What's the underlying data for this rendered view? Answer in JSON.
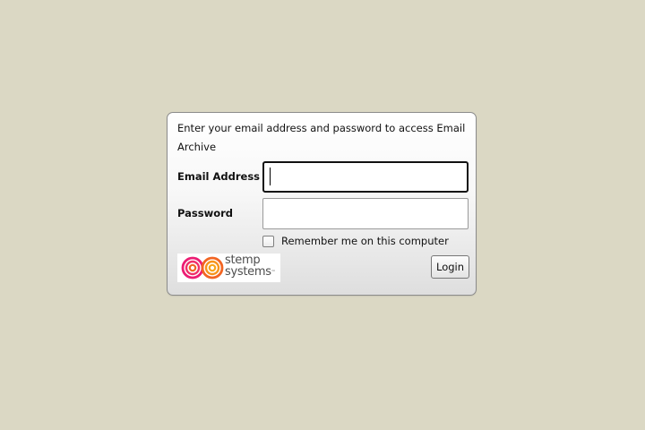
{
  "login_panel": {
    "instructions": "Enter your email address and password to access Email Archive",
    "email": {
      "label": "Email Address",
      "value": "",
      "placeholder": ""
    },
    "password": {
      "label": "Password",
      "value": "",
      "placeholder": ""
    },
    "remember": {
      "label": "Remember me on this computer",
      "checked": false
    },
    "login_button": "Login",
    "logo": {
      "line1": "stemp",
      "line2": "systems",
      "trademark": "™",
      "icon": "infinity-spiral-icon",
      "colors": [
        "#ec1c73",
        "#f26522",
        "#f7941d"
      ]
    }
  }
}
